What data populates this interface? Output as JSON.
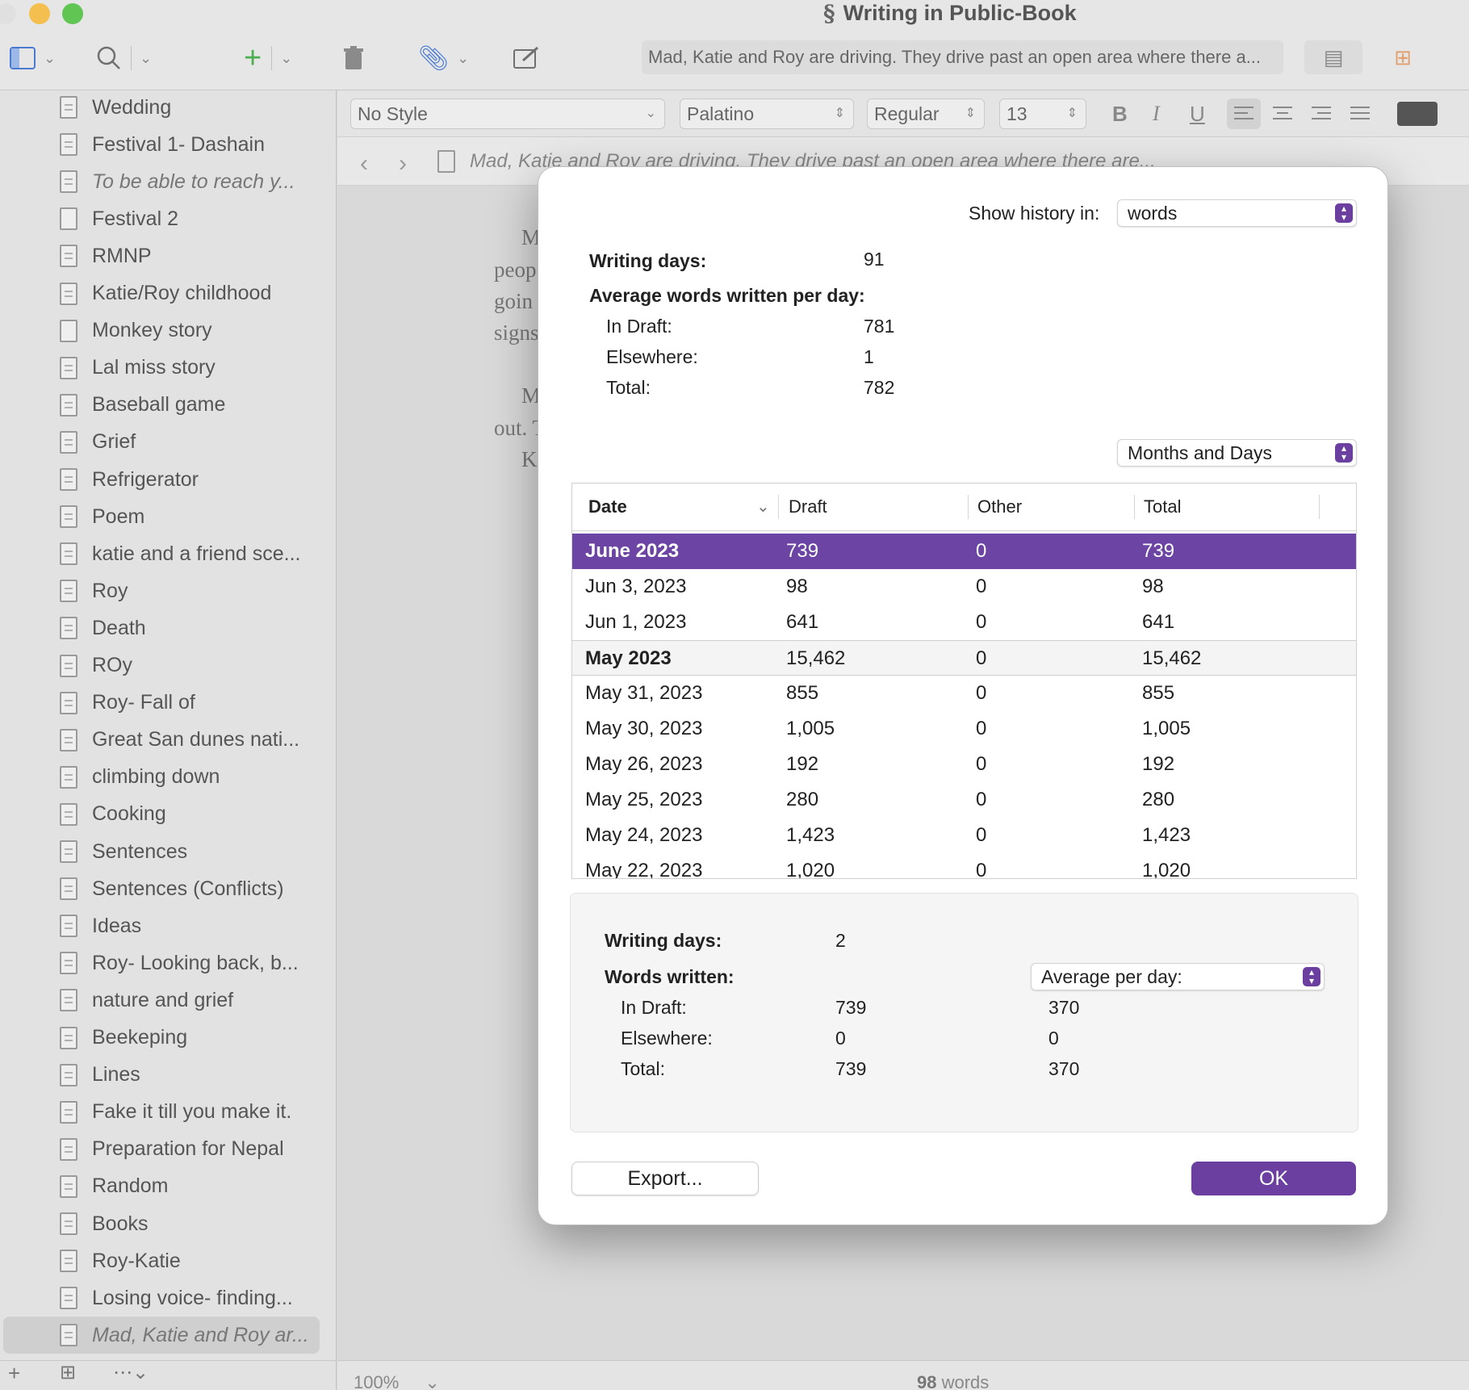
{
  "window": {
    "title": "Writing in Public-Book",
    "traffic_colors": [
      "#e0e0e0",
      "#f4bf4f",
      "#61c554"
    ],
    "quick_reference": "Mad, Katie and Roy are driving. They drive past an open area where there a..."
  },
  "toolbar": {
    "icons": [
      "binder-toggle-icon",
      "search-icon",
      "add-icon",
      "trash-icon",
      "paperclip-icon",
      "compose-icon"
    ]
  },
  "format_bar": {
    "style": "No Style",
    "font": "Palatino",
    "weight": "Regular",
    "size": "13",
    "bold": "B",
    "italic": "I",
    "underline": "U"
  },
  "nav_bar": {
    "back": "‹",
    "forward": "›",
    "title": "Mad, Katie and Roy are driving. They drive past an open area where there are..."
  },
  "editor": {
    "lines": [
      "M",
      "peop",
      "goin",
      "signs",
      "M",
      "out. T",
      "K"
    ],
    "zoom": "100%",
    "word_count_number": "98",
    "word_count_label": "words"
  },
  "binder": {
    "items": [
      {
        "label": "Wedding",
        "italic": false,
        "blank": false
      },
      {
        "label": "Festival 1- Dashain",
        "italic": false,
        "blank": false
      },
      {
        "label": "To be able to reach y...",
        "italic": true,
        "blank": false
      },
      {
        "label": "Festival 2",
        "italic": false,
        "blank": true
      },
      {
        "label": "RMNP",
        "italic": false,
        "blank": false
      },
      {
        "label": "Katie/Roy childhood",
        "italic": false,
        "blank": false
      },
      {
        "label": "Monkey story",
        "italic": false,
        "blank": true
      },
      {
        "label": "Lal miss story",
        "italic": false,
        "blank": false
      },
      {
        "label": "Baseball game",
        "italic": false,
        "blank": false
      },
      {
        "label": "Grief",
        "italic": false,
        "blank": false
      },
      {
        "label": "Refrigerator",
        "italic": false,
        "blank": false
      },
      {
        "label": "Poem",
        "italic": false,
        "blank": false
      },
      {
        "label": "katie and a friend sce...",
        "italic": false,
        "blank": false
      },
      {
        "label": "Roy",
        "italic": false,
        "blank": false
      },
      {
        "label": "Death",
        "italic": false,
        "blank": false
      },
      {
        "label": "ROy",
        "italic": false,
        "blank": false
      },
      {
        "label": "Roy- Fall of",
        "italic": false,
        "blank": false
      },
      {
        "label": "Great San dunes nati...",
        "italic": false,
        "blank": false
      },
      {
        "label": "climbing down",
        "italic": false,
        "blank": false
      },
      {
        "label": "Cooking",
        "italic": false,
        "blank": false
      },
      {
        "label": "Sentences",
        "italic": false,
        "blank": false
      },
      {
        "label": "Sentences (Conflicts)",
        "italic": false,
        "blank": false
      },
      {
        "label": "Ideas",
        "italic": false,
        "blank": false
      },
      {
        "label": "Roy- Looking back, b...",
        "italic": false,
        "blank": false
      },
      {
        "label": "nature and grief",
        "italic": false,
        "blank": false
      },
      {
        "label": "Beekeping",
        "italic": false,
        "blank": false
      },
      {
        "label": "Lines",
        "italic": false,
        "blank": false
      },
      {
        "label": "Fake it till you make it.",
        "italic": false,
        "blank": false
      },
      {
        "label": "Preparation for Nepal",
        "italic": false,
        "blank": false
      },
      {
        "label": "Random",
        "italic": false,
        "blank": false
      },
      {
        "label": "Books",
        "italic": false,
        "blank": false
      },
      {
        "label": "Roy-Katie",
        "italic": false,
        "blank": false
      },
      {
        "label": "Losing voice- finding...",
        "italic": false,
        "blank": false
      },
      {
        "label": "Mad, Katie and Roy ar...",
        "italic": true,
        "blank": false,
        "selected": true
      }
    ]
  },
  "dialog": {
    "show_history_label": "Show history in:",
    "show_history_value": "words",
    "writing_days_label": "Writing days:",
    "writing_days_value": "91",
    "average_label": "Average words written per day:",
    "in_draft_label": "In Draft:",
    "in_draft_value": "781",
    "elsewhere_label": "Elsewhere:",
    "elsewhere_value": "1",
    "total_label": "Total:",
    "total_value": "782",
    "grouping_value": "Months and Days",
    "table": {
      "columns": [
        "Date",
        "Draft",
        "Other",
        "Total"
      ],
      "rows": [
        {
          "date": "June 2023",
          "draft": "739",
          "other": "0",
          "total": "739",
          "kind": "month",
          "selected": true
        },
        {
          "date": "Jun 3, 2023",
          "draft": "98",
          "other": "0",
          "total": "98",
          "kind": "day"
        },
        {
          "date": "Jun 1, 2023",
          "draft": "641",
          "other": "0",
          "total": "641",
          "kind": "day"
        },
        {
          "date": "May 2023",
          "draft": "15,462",
          "other": "0",
          "total": "15,462",
          "kind": "month"
        },
        {
          "date": "May 31, 2023",
          "draft": "855",
          "other": "0",
          "total": "855",
          "kind": "day"
        },
        {
          "date": "May 30, 2023",
          "draft": "1,005",
          "other": "0",
          "total": "1,005",
          "kind": "day"
        },
        {
          "date": "May 26, 2023",
          "draft": "192",
          "other": "0",
          "total": "192",
          "kind": "day"
        },
        {
          "date": "May 25, 2023",
          "draft": "280",
          "other": "0",
          "total": "280",
          "kind": "day"
        },
        {
          "date": "May 24, 2023",
          "draft": "1,423",
          "other": "0",
          "total": "1,423",
          "kind": "day"
        },
        {
          "date": "May 22, 2023",
          "draft": "1,020",
          "other": "0",
          "total": "1,020",
          "kind": "day"
        }
      ]
    },
    "summary": {
      "writing_days_label": "Writing days:",
      "writing_days_value": "2",
      "words_written_label": "Words written:",
      "mode_value": "Average per day:",
      "in_draft_label": "In Draft:",
      "in_draft_value": "739",
      "in_draft_avg": "370",
      "elsewhere_label": "Elsewhere:",
      "elsewhere_value": "0",
      "elsewhere_avg": "0",
      "total_label": "Total:",
      "total_value": "739",
      "total_avg": "370"
    },
    "export_label": "Export...",
    "ok_label": "OK",
    "accent_color": "#6b3fa0"
  }
}
